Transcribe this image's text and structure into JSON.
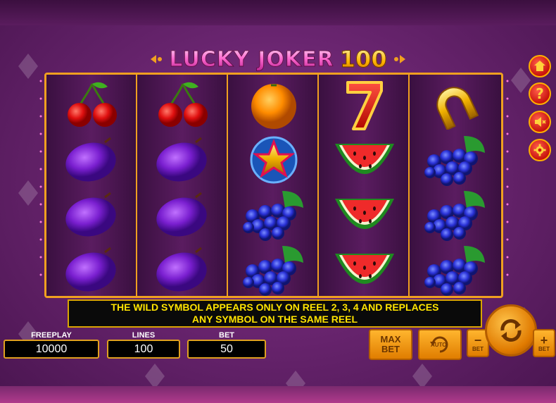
{
  "title": {
    "main": "LUCKY JOKER",
    "number": "100"
  },
  "reels": [
    {
      "symbols": [
        "cherry-icon",
        "plum-icon",
        "plum-icon",
        "plum-icon"
      ]
    },
    {
      "symbols": [
        "cherry-icon",
        "plum-icon",
        "plum-icon",
        "plum-icon"
      ]
    },
    {
      "symbols": [
        "orange-icon",
        "star-icon",
        "grapes-icon",
        "grapes-icon"
      ]
    },
    {
      "symbols": [
        "seven-icon",
        "watermelon-icon",
        "watermelon-icon",
        "watermelon-icon"
      ]
    },
    {
      "symbols": [
        "horseshoe-icon",
        "grapes-icon",
        "grapes-icon",
        "grapes-icon"
      ]
    }
  ],
  "info_message": "THE WILD SYMBOL APPEARS ONLY ON REEL 2, 3, 4 AND REPLACES\nANY SYMBOL ON THE SAME REEL",
  "stats": {
    "freeplay_label": "FREEPLAY",
    "freeplay_value": "10000",
    "lines_label": "LINES",
    "lines_value": "100",
    "bet_label": "BET",
    "bet_value": "50"
  },
  "buttons": {
    "max_bet_line1": "MAX",
    "max_bet_line2": "BET",
    "auto_label": "AUTO",
    "bet_minus_label": "BET",
    "bet_plus_label": "BET"
  },
  "side_buttons": [
    "home-icon",
    "help-icon",
    "sound-off-icon",
    "gear-icon"
  ],
  "colors": {
    "frame": "#f0a020",
    "info_text": "#ffe400",
    "side_button": "#d4180e"
  }
}
